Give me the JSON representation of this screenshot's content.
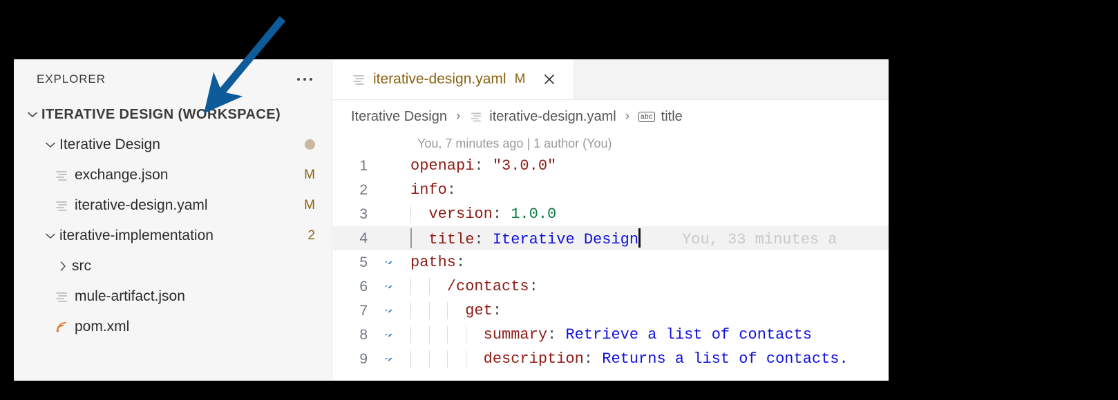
{
  "colors": {
    "arrow": "#0d5b99",
    "modified_file": "#8a6312",
    "folder": "#8a6312",
    "string": "#1111dd",
    "key": "#8f1a14",
    "number": "#0a7d44",
    "sidebar_bg": "#f6f6f6",
    "tab_active_bg": "#ffffff",
    "dirty_dot": "#c9b79f",
    "gutter_change": "#1f6fc4"
  },
  "sidebar": {
    "header": {
      "title": "EXPLORER",
      "more_actions": "..."
    },
    "workspace": {
      "label": "ITERATIVE DESIGN (WORKSPACE)",
      "expanded": true
    },
    "items": [
      {
        "label": "Iterative Design",
        "icon": "chevron-down-icon",
        "kind": "folder",
        "indent": 1,
        "badge": "",
        "dirty": true,
        "color": "folder"
      },
      {
        "label": "exchange.json",
        "icon": "yaml-file-icon",
        "kind": "file",
        "indent": 2,
        "badge": "M",
        "dirty": false,
        "color": "modified"
      },
      {
        "label": "iterative-design.yaml",
        "icon": "yaml-file-icon",
        "kind": "file",
        "indent": 2,
        "badge": "M",
        "dirty": false,
        "color": "modified"
      },
      {
        "label": "iterative-implementation",
        "icon": "chevron-down-icon",
        "kind": "folder",
        "indent": 1,
        "badge": "2",
        "dirty": false,
        "color": "folder"
      },
      {
        "label": "src",
        "icon": "chevron-right-icon",
        "kind": "folder",
        "indent": 2,
        "badge": "",
        "dirty": false,
        "color": "plain"
      },
      {
        "label": "mule-artifact.json",
        "icon": "yaml-file-icon",
        "kind": "file",
        "indent": 2,
        "badge": "",
        "dirty": false,
        "color": "plain"
      },
      {
        "label": "pom.xml",
        "icon": "xml-file-icon",
        "kind": "file",
        "indent": 2,
        "badge": "",
        "dirty": false,
        "color": "plain"
      }
    ]
  },
  "editor": {
    "tab": {
      "filename": "iterative-design.yaml",
      "modified_badge": "M",
      "close_label": "Close",
      "icon": "yaml-file-icon"
    },
    "breadcrumb": [
      {
        "label": "Iterative Design",
        "icon": ""
      },
      {
        "label": "iterative-design.yaml",
        "icon": "yaml-file-icon"
      },
      {
        "label": "title",
        "icon": "abc-string-icon"
      }
    ],
    "breadcrumb_separator": "›",
    "blame_header": "You, 7 minutes ago | 1 author (You)",
    "inline_blame": "You, 33 minutes a",
    "lines": [
      {
        "n": "1",
        "changed": false,
        "current": false,
        "indents": 0,
        "tokens": [
          {
            "t": "openapi",
            "c": "k"
          },
          {
            "t": ": ",
            "c": "punc"
          },
          {
            "t": "\"3.0.0\"",
            "c": "k"
          }
        ]
      },
      {
        "n": "2",
        "changed": false,
        "current": false,
        "indents": 0,
        "tokens": [
          {
            "t": "info",
            "c": "k"
          },
          {
            "t": ":",
            "c": "punc"
          }
        ]
      },
      {
        "n": "3",
        "changed": false,
        "current": false,
        "indents": 1,
        "tokens": [
          {
            "t": "  version",
            "c": "k"
          },
          {
            "t": ": ",
            "c": "punc"
          },
          {
            "t": "1.0.0",
            "c": "num"
          }
        ]
      },
      {
        "n": "4",
        "changed": false,
        "current": true,
        "indents": 1,
        "tokens": [
          {
            "t": "  title",
            "c": "k"
          },
          {
            "t": ": ",
            "c": "punc"
          },
          {
            "t": "Iterative Design",
            "c": "str"
          }
        ]
      },
      {
        "n": "5",
        "changed": true,
        "current": false,
        "indents": 0,
        "tokens": [
          {
            "t": "paths",
            "c": "k"
          },
          {
            "t": ":",
            "c": "punc"
          }
        ]
      },
      {
        "n": "6",
        "changed": true,
        "current": false,
        "indents": 2,
        "tokens": [
          {
            "t": "    /contacts",
            "c": "k"
          },
          {
            "t": ":",
            "c": "punc"
          }
        ]
      },
      {
        "n": "7",
        "changed": true,
        "current": false,
        "indents": 3,
        "tokens": [
          {
            "t": "      get",
            "c": "k"
          },
          {
            "t": ":",
            "c": "punc"
          }
        ]
      },
      {
        "n": "8",
        "changed": true,
        "current": false,
        "indents": 4,
        "tokens": [
          {
            "t": "        summary",
            "c": "k"
          },
          {
            "t": ": ",
            "c": "punc"
          },
          {
            "t": "Retrieve a list of contacts",
            "c": "str"
          }
        ]
      },
      {
        "n": "9",
        "changed": true,
        "current": false,
        "indents": 4,
        "tokens": [
          {
            "t": "        description",
            "c": "k"
          },
          {
            "t": ": ",
            "c": "punc"
          },
          {
            "t": "Returns a list of contacts.",
            "c": "str"
          }
        ]
      }
    ]
  },
  "annotation": {
    "type": "arrow",
    "points_to": "ITERATIVE DESIGN (WORKSPACE)"
  }
}
